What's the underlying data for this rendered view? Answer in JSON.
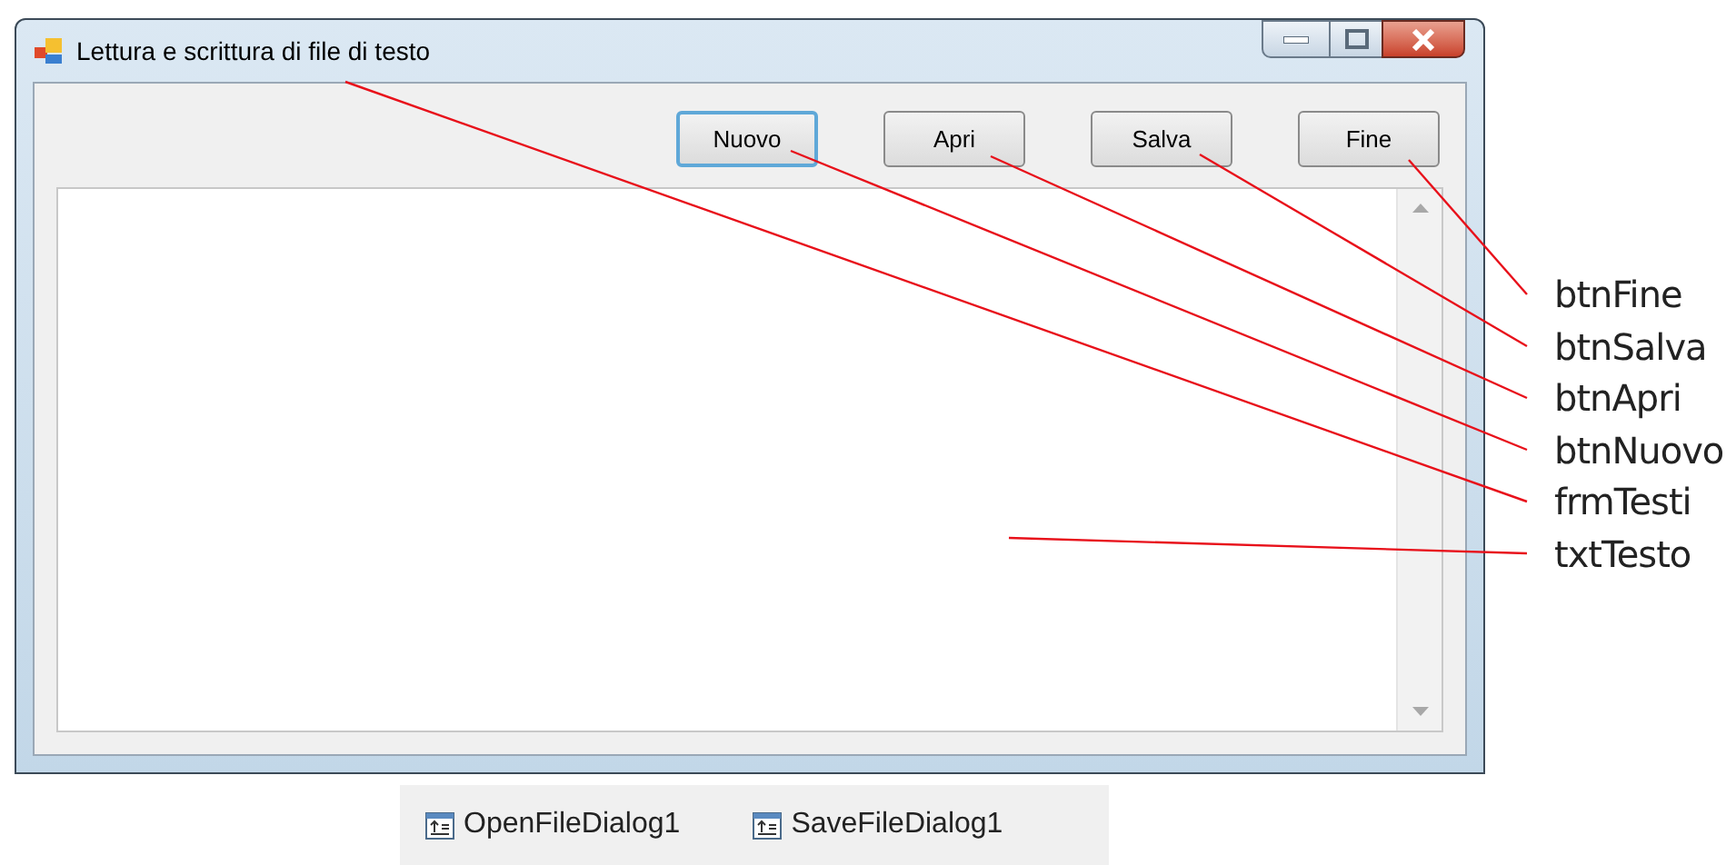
{
  "window": {
    "title": "Lettura e scrittura di file di testo"
  },
  "buttons": [
    {
      "label": "Nuovo",
      "focused": true
    },
    {
      "label": "Apri",
      "focused": false
    },
    {
      "label": "Salva",
      "focused": false
    },
    {
      "label": "Fine",
      "focused": false
    }
  ],
  "callouts": [
    "btnFine",
    "btnSalva",
    "btnApri",
    "btnNuovo",
    "frmTesti",
    "txtTesto"
  ],
  "component_tray": [
    "OpenFileDialog1",
    "SaveFileDialog1"
  ]
}
